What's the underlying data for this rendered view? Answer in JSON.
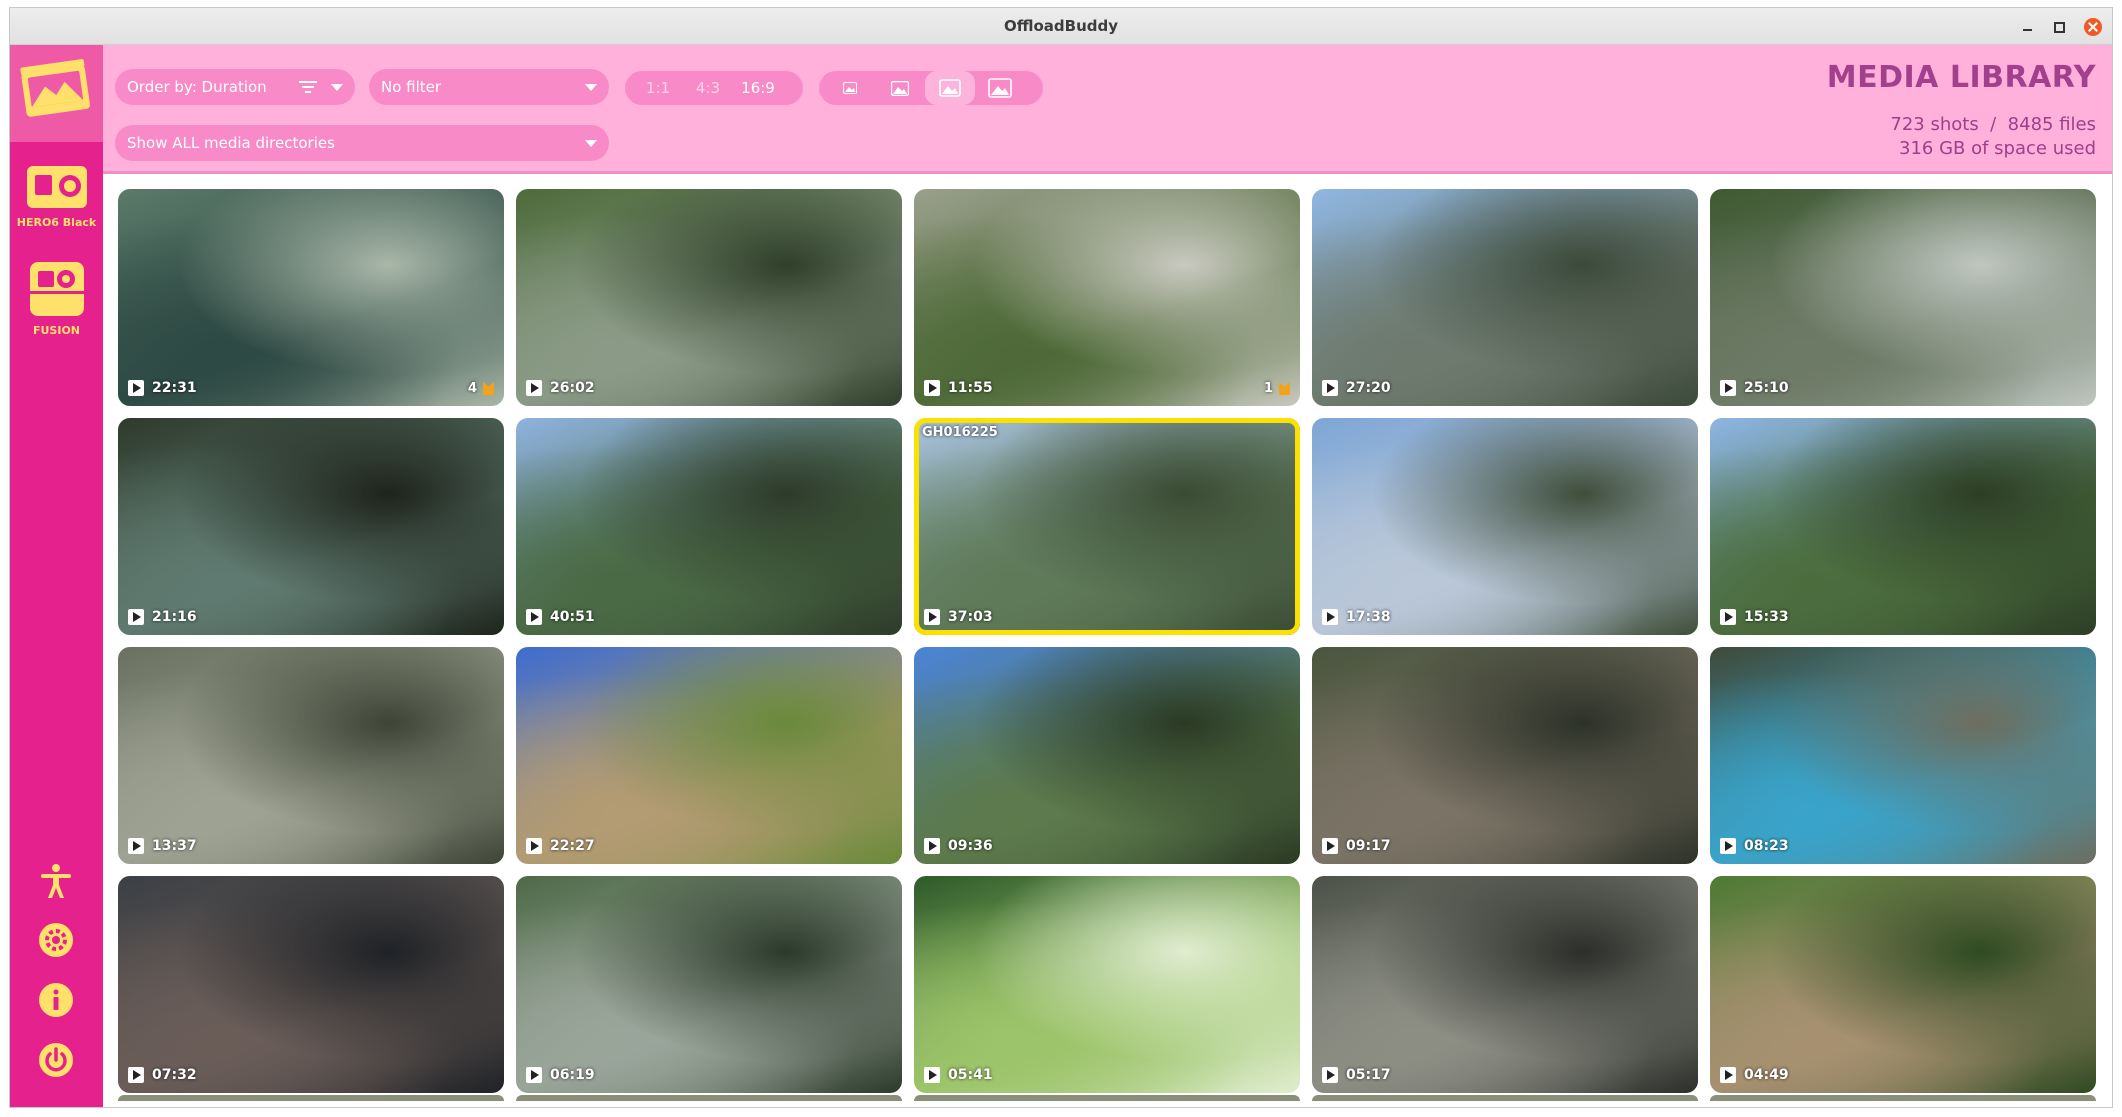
{
  "window": {
    "title": "OffloadBuddy"
  },
  "sidebar": {
    "cameras": [
      {
        "label": "HERO6 Black"
      },
      {
        "label": "FUSION"
      }
    ],
    "bottom_icons": [
      "accessibility-icon",
      "settings-gear-icon",
      "info-icon",
      "power-icon"
    ],
    "accent": "#e5218d"
  },
  "header": {
    "order_by": "Order by: Duration",
    "filter": "No filter",
    "directories": "Show ALL media directories",
    "ratios": [
      "1:1",
      "4:3",
      "16:9"
    ],
    "active_ratio": "16:9",
    "thumb_size_active_index": 2,
    "title": "MEDIA LIBRARY",
    "stats_line1": "723 shots  /  8485 files",
    "stats_line2": "316 GB of space used"
  },
  "media": [
    {
      "duration": "22:31",
      "highlights": "4",
      "colors": [
        "#5b7a6a",
        "#2e4a44",
        "#a9b7a8"
      ]
    },
    {
      "duration": "26:02",
      "colors": [
        "#4e6b3a",
        "#8a9a86",
        "#2f3f2a"
      ]
    },
    {
      "duration": "11:55",
      "highlights": "1",
      "colors": [
        "#9aa08c",
        "#4f6a38",
        "#c9c9c0"
      ]
    },
    {
      "duration": "27:20",
      "colors": [
        "#8fb7e3",
        "#6e7a6e",
        "#3c4a3a"
      ]
    },
    {
      "duration": "25:10",
      "colors": [
        "#3f5a32",
        "#6d7a66",
        "#bfc7c0"
      ]
    },
    {
      "duration": "21:16",
      "colors": [
        "#2e3a2c",
        "#5f7a70",
        "#1e241c"
      ]
    },
    {
      "duration": "40:51",
      "colors": [
        "#8fb3df",
        "#4a6a45",
        "#2e3b2a"
      ]
    },
    {
      "duration": "37:03",
      "filename": "GH016225",
      "selected": true,
      "colors": [
        "#a9c3e0",
        "#5e7a58",
        "#3b4b34"
      ]
    },
    {
      "duration": "17:38",
      "colors": [
        "#7ea6d6",
        "#b9c7d8",
        "#3f4e3a"
      ]
    },
    {
      "duration": "15:33",
      "colors": [
        "#8eb6e4",
        "#4b6d3e",
        "#2d3e25"
      ]
    },
    {
      "duration": "13:37",
      "colors": [
        "#6a7160",
        "#9ea292",
        "#3e4536"
      ]
    },
    {
      "duration": "22:27",
      "colors": [
        "#3d6cd0",
        "#b39b72",
        "#6a8a3a"
      ]
    },
    {
      "duration": "09:36",
      "colors": [
        "#4a84d8",
        "#5c7a4c",
        "#2b3a24"
      ]
    },
    {
      "duration": "09:17",
      "colors": [
        "#4a553e",
        "#7b7366",
        "#2d3228"
      ]
    },
    {
      "duration": "08:23",
      "colors": [
        "#3f4a3a",
        "#3aa3c9",
        "#6d6e5e"
      ]
    },
    {
      "duration": "07:32",
      "colors": [
        "#3b3f44",
        "#6a5d58",
        "#1f2226"
      ]
    },
    {
      "duration": "06:19",
      "colors": [
        "#4f6a48",
        "#9aa59a",
        "#2b3a2a"
      ]
    },
    {
      "duration": "05:41",
      "colors": [
        "#2e5a2a",
        "#9cc46a",
        "#e0edd0"
      ]
    },
    {
      "duration": "05:17",
      "colors": [
        "#4d5248",
        "#8c8e84",
        "#2c2f2a"
      ]
    },
    {
      "duration": "04:49",
      "colors": [
        "#4e7a34",
        "#a69070",
        "#2f4a22"
      ]
    }
  ]
}
